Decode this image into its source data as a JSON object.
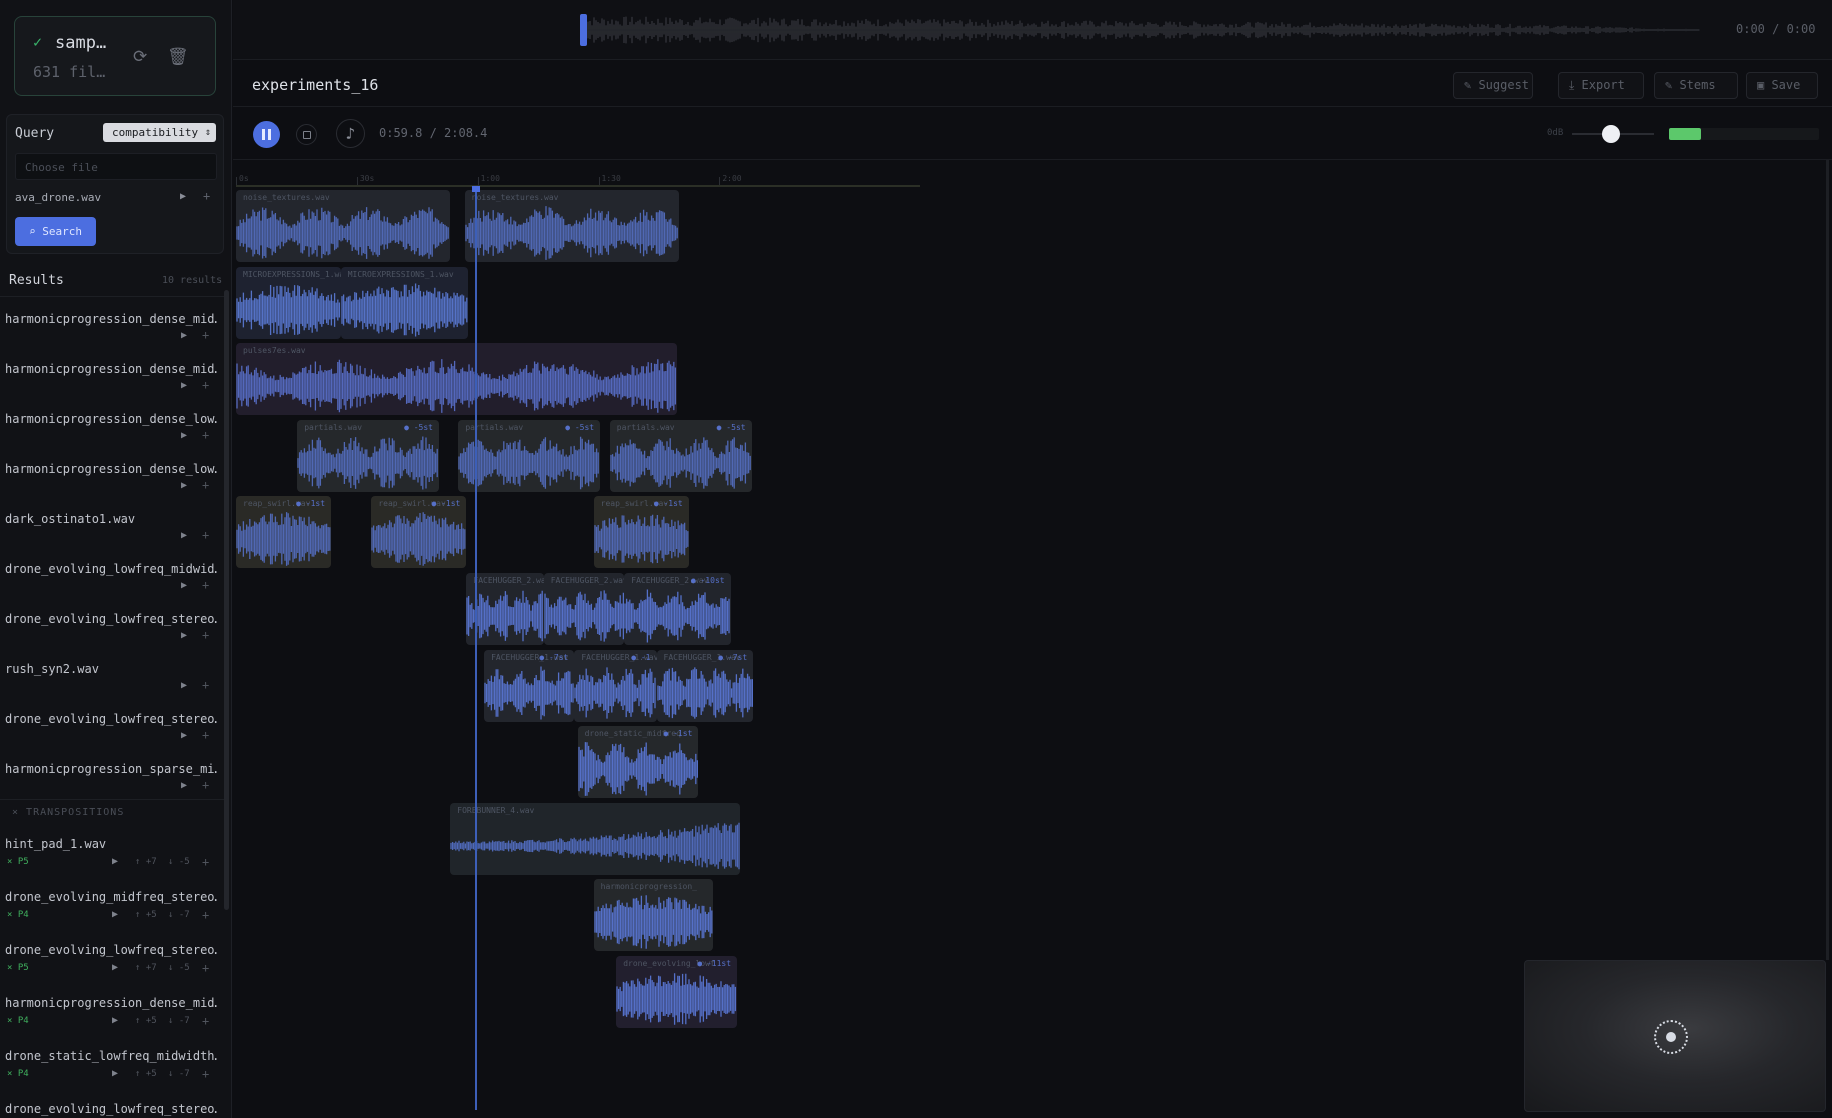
{
  "source": {
    "name": "samp…",
    "count": "631 fil…"
  },
  "query": {
    "label": "Query",
    "mode": "compatibility",
    "file_placeholder": "Choose file",
    "selected_file": "ava_drone.wav",
    "search_label": "Search"
  },
  "results": {
    "title": "Results",
    "count": "10 results",
    "items": [
      "harmonicprogression_dense_mid…",
      "harmonicprogression_dense_mid…",
      "harmonicprogression_dense_low…",
      "harmonicprogression_dense_low…",
      "dark_ostinato1.wav",
      "drone_evolving_lowfreq_midwid…",
      "drone_evolving_lowfreq_stereo…",
      "rush_syn2.wav",
      "drone_evolving_lowfreq_stereo…",
      "harmonicprogression_sparse_mi…"
    ]
  },
  "transpositions": {
    "header": "TRANSPOSITIONS",
    "items": [
      {
        "name": "hint_pad_1.wav",
        "tag": "P5",
        "up": "+7",
        "down": "-5"
      },
      {
        "name": "drone_evolving_midfreq_stereo…",
        "tag": "P4",
        "up": "+5",
        "down": "-7"
      },
      {
        "name": "drone_evolving_lowfreq_stereo…",
        "tag": "P5",
        "up": "+7",
        "down": "-5"
      },
      {
        "name": "harmonicprogression_dense_mid…",
        "tag": "P4",
        "up": "+5",
        "down": "-7"
      },
      {
        "name": "drone_static_lowfreq_midwidth…",
        "tag": "P4",
        "up": "+5",
        "down": "-7"
      },
      {
        "name": "drone_evolving_lowfreq_stereo…",
        "tag": "",
        "up": "",
        "down": ""
      }
    ]
  },
  "overview": {
    "time": "0:00 / 0:00",
    "handle_position": 0
  },
  "project": {
    "title": "experiments_16"
  },
  "header_buttons": {
    "suggest": "Suggest",
    "export": "Export",
    "stems": "Stems",
    "save": "Save"
  },
  "transport": {
    "time": "0:59.8 / 2:08.4",
    "volume_label": "0dB",
    "volume_level": 0.47,
    "meter_level": 0.21
  },
  "ruler": {
    "labels": [
      "0s",
      "30s",
      "1:00",
      "1:30",
      "2:00"
    ],
    "playhead_seconds": 59.8
  },
  "tracks": [
    {
      "color": "#23262d",
      "wave": "#5068b4",
      "clips": [
        {
          "label": "noise_textures.wav",
          "transpose": "",
          "start": 0,
          "end": 53.2
        },
        {
          "label": "noise_textures.wav",
          "transpose": "",
          "start": 56.8,
          "end": 110
        }
      ]
    },
    {
      "color": "#1e2230",
      "wave": "#5572c6",
      "clips": [
        {
          "label": "MICROEXPRESSIONS_1.wav",
          "transpose": "",
          "start": 0,
          "end": 26
        },
        {
          "label": "MICROEXPRESSIONS_1.wav",
          "transpose": "",
          "start": 26,
          "end": 57.6
        }
      ]
    },
    {
      "color": "#221e2c",
      "wave": "#5468bc",
      "clips": [
        {
          "label": "pulses7es.wav",
          "transpose": "",
          "start": 0,
          "end": 109.6
        }
      ]
    },
    {
      "color": "#25282b",
      "wave": "#5068b4",
      "clips": [
        {
          "label": "partials.wav",
          "transpose": "-5st",
          "start": 15.2,
          "end": 50.4
        },
        {
          "label": "partials.wav",
          "transpose": "-5st",
          "start": 55.2,
          "end": 90.4
        },
        {
          "label": "partials.wav",
          "transpose": "-5st",
          "start": 92.8,
          "end": 128
        }
      ]
    },
    {
      "color": "#2a2a26",
      "wave": "#5068b4",
      "clips": [
        {
          "label": "reap_swirl.wav",
          "transpose": "-1st",
          "start": 0,
          "end": 23.6
        },
        {
          "label": "reap_swirl.wav",
          "transpose": "-1st",
          "start": 33.6,
          "end": 57.2
        },
        {
          "label": "reap_swirl.wav",
          "transpose": "-1st",
          "start": 88.8,
          "end": 112.4
        }
      ]
    },
    {
      "color": "#22252c",
      "wave": "#5570c8",
      "clips": [
        {
          "label": "FACEHUGGER_2.wav",
          "transpose": "",
          "start": 57.2,
          "end": 76.4
        },
        {
          "label": "FACEHUGGER_2.wav",
          "transpose": "",
          "start": 76.4,
          "end": 96.4
        },
        {
          "label": "FACEHUGGER_2.wav",
          "transpose": "-10st",
          "start": 96.4,
          "end": 122.8
        }
      ]
    },
    {
      "color": "#23262d",
      "wave": "#5570c8",
      "clips": [
        {
          "label": "FACEHUGGER_1.wav",
          "transpose": "-7st",
          "start": 61.6,
          "end": 84
        },
        {
          "label": "FACEHUGGER_1.wav",
          "transpose": "-1",
          "start": 84,
          "end": 104.4
        },
        {
          "label": "FACEHUGGER_1.wav",
          "transpose": "-7st",
          "start": 104.4,
          "end": 128.4
        }
      ]
    },
    {
      "color": "#25282b",
      "wave": "#5570c8",
      "clips": [
        {
          "label": "drone_static_midfreq",
          "transpose": "-1st",
          "start": 84.8,
          "end": 114.8
        }
      ]
    },
    {
      "color": "#20252a",
      "wave": "#4f69b8",
      "clips": [
        {
          "label": "FOREBUNNER_4.wav",
          "transpose": "",
          "start": 53.2,
          "end": 125.2
        }
      ]
    },
    {
      "color": "#25282b",
      "wave": "#5570c8",
      "clips": [
        {
          "label": "harmonicprogression_",
          "transpose": "",
          "start": 88.8,
          "end": 118.4
        }
      ]
    },
    {
      "color": "#221f2e",
      "wave": "#5570c8",
      "clips": [
        {
          "label": "drone_evolving_lowf",
          "transpose": "-11st",
          "start": 94.4,
          "end": 124.4
        }
      ]
    }
  ],
  "icons": {
    "check": "check-icon",
    "refresh": "refresh-icon",
    "trash": "trash-icon",
    "search": "search-icon",
    "play": "play-icon",
    "plus": "plus-icon",
    "pause": "pause-icon",
    "stop": "stop-icon",
    "metronome": "metronome-icon"
  },
  "colors": {
    "accent": "#4c6ee0",
    "meter": "#5cc86b",
    "tag": "#3fae5d"
  }
}
